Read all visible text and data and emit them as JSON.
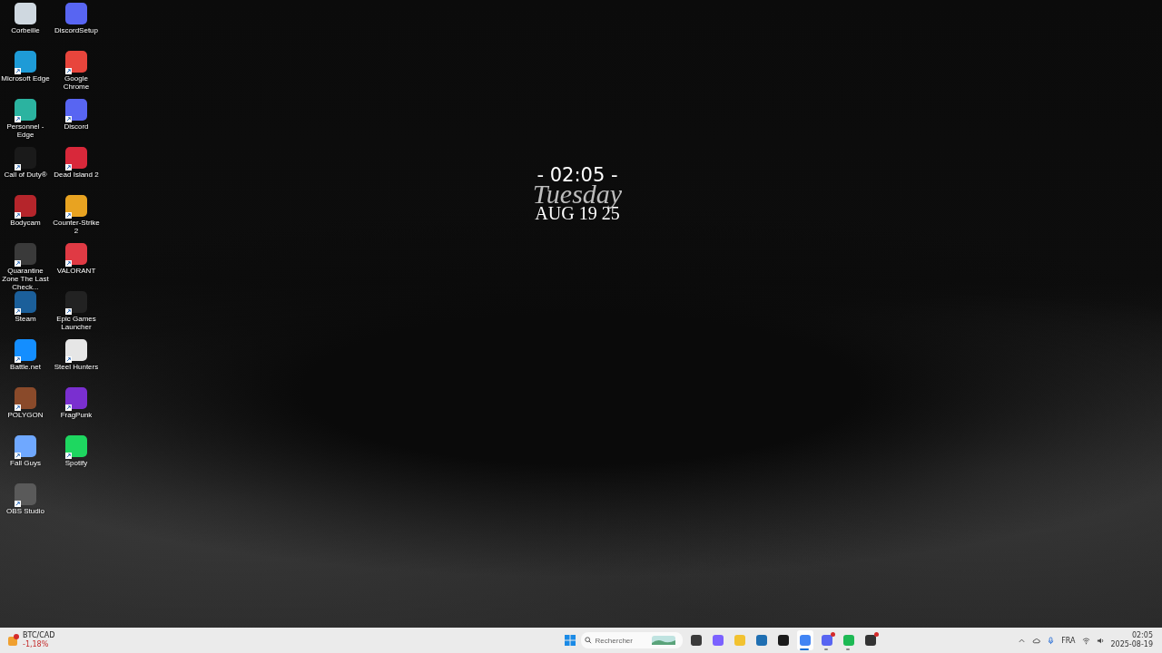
{
  "desktop_icons": [
    {
      "label": "Corbeille",
      "color": "#cfd8e0",
      "shortcut": false
    },
    {
      "label": "DiscordSetup",
      "color": "#5865f2",
      "shortcut": false
    },
    {
      "label": "Microsoft Edge",
      "color": "#1e9bd7",
      "shortcut": true
    },
    {
      "label": "Google Chrome",
      "color": "#e8453c",
      "shortcut": true
    },
    {
      "label": "Personnel - Edge",
      "color": "#2bb3a0",
      "shortcut": true
    },
    {
      "label": "Discord",
      "color": "#5865f2",
      "shortcut": true
    },
    {
      "label": "Call of Duty®",
      "color": "#1a1a1a",
      "shortcut": true
    },
    {
      "label": "Dead Island 2",
      "color": "#d8283a",
      "shortcut": true
    },
    {
      "label": "Bodycam",
      "color": "#b5252b",
      "shortcut": true
    },
    {
      "label": "Counter-Strike 2",
      "color": "#e8a321",
      "shortcut": true
    },
    {
      "label": "Quarantine Zone The Last Check...",
      "color": "#3a3a3a",
      "shortcut": true
    },
    {
      "label": "VALORANT",
      "color": "#e03a44",
      "shortcut": true
    },
    {
      "label": "Steam",
      "color": "#1b5f9a",
      "shortcut": true
    },
    {
      "label": "Epic Games Launcher",
      "color": "#222222",
      "shortcut": true
    },
    {
      "label": "Battle.net",
      "color": "#148eff",
      "shortcut": true
    },
    {
      "label": "Steel Hunters",
      "color": "#e6e6e6",
      "shortcut": true
    },
    {
      "label": "POLYGON",
      "color": "#8a4a2a",
      "shortcut": true
    },
    {
      "label": "FragPunk",
      "color": "#7a2fd0",
      "shortcut": true
    },
    {
      "label": "Fall Guys",
      "color": "#6fa8ff",
      "shortcut": true
    },
    {
      "label": "Spotify",
      "color": "#1ed760",
      "shortcut": true
    },
    {
      "label": "OBS Studio",
      "color": "#5a5a5a",
      "shortcut": true
    }
  ],
  "clock_widget": {
    "time": "- 02:05 -",
    "weekday": "Tuesday",
    "date": "AUG 19 25"
  },
  "taskbar": {
    "widget": {
      "title": "BTC/CAD",
      "change": "-1,18%",
      "badge": true
    },
    "search": {
      "placeholder": "Rechercher"
    },
    "apps": [
      {
        "color": "#3a3a3a",
        "running": false,
        "selected": false,
        "badge": false
      },
      {
        "color": "#7b61ff",
        "running": false,
        "selected": false,
        "badge": false
      },
      {
        "color": "#f2c230",
        "running": false,
        "selected": false,
        "badge": false
      },
      {
        "color": "#1f6fb2",
        "running": false,
        "selected": false,
        "badge": false
      },
      {
        "color": "#1a1a1a",
        "running": false,
        "selected": false,
        "badge": false
      },
      {
        "color": "#4285f4",
        "running": true,
        "selected": true,
        "badge": false
      },
      {
        "color": "#5865f2",
        "running": true,
        "selected": false,
        "badge": true
      },
      {
        "color": "#1db954",
        "running": true,
        "selected": false,
        "badge": false
      },
      {
        "color": "#333333",
        "running": false,
        "selected": false,
        "badge": true
      }
    ],
    "language": "FRA",
    "time": "02:05",
    "date": "2025-08-19"
  }
}
